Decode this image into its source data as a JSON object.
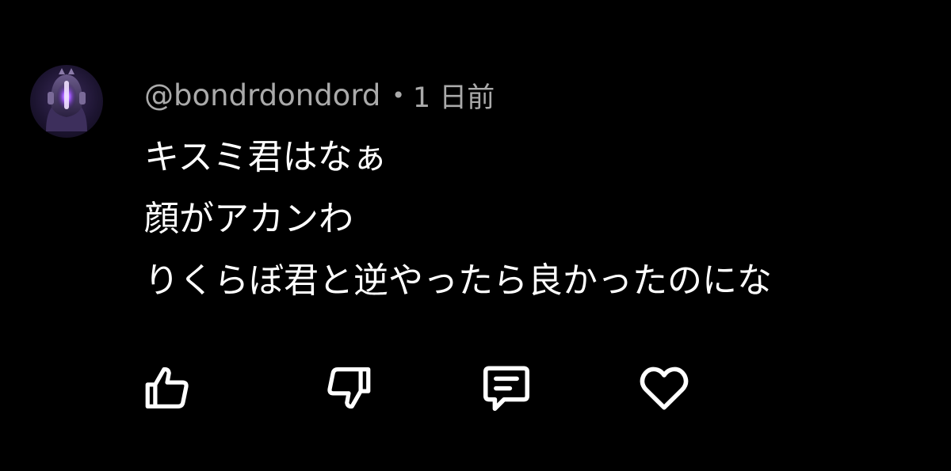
{
  "comment": {
    "author": {
      "handle": "@bondrdondord",
      "avatar_icon": "robot-helmet-avatar"
    },
    "separator": "•",
    "timestamp": "1 日前",
    "lines": [
      "キスミ君はなぁ",
      "顔がアカンわ",
      "りくらぼ君と逆やったら良かったのにな"
    ],
    "actions": [
      {
        "icon": "thumbs-up-icon"
      },
      {
        "icon": "thumbs-down-icon"
      },
      {
        "icon": "reply-comment-icon"
      },
      {
        "icon": "heart-icon"
      }
    ]
  },
  "colors": {
    "background": "#000000",
    "text_primary": "#ffffff",
    "text_secondary": "#aaaaaa",
    "avatar_accent": "#a45bff"
  }
}
